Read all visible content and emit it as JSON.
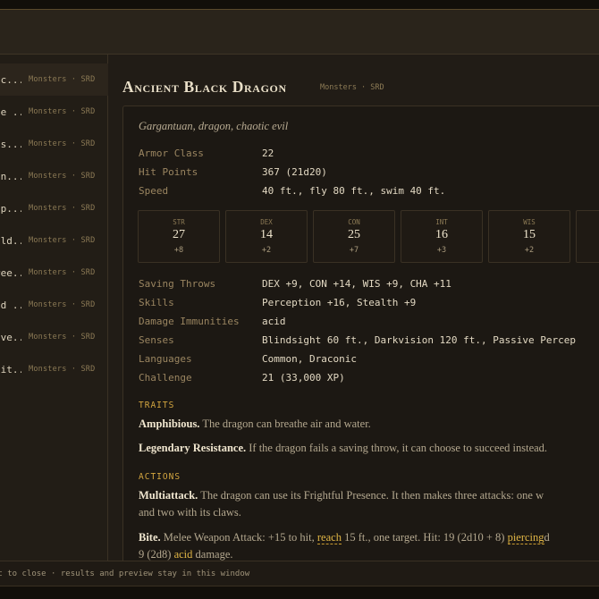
{
  "results": [
    {
      "name": "ac...",
      "meta": "Monsters · SRD"
    },
    {
      "name": "ue ...",
      "meta": "Monsters · SRD"
    },
    {
      "name": "as...",
      "meta": "Monsters · SRD"
    },
    {
      "name": "on...",
      "meta": "Monsters · SRD"
    },
    {
      "name": "op...",
      "meta": "Monsters · SRD"
    },
    {
      "name": "old...",
      "meta": "Monsters · SRD"
    },
    {
      "name": "ree...",
      "meta": "Monsters · SRD"
    },
    {
      "name": "ed ...",
      "meta": "Monsters · SRD"
    },
    {
      "name": "ive...",
      "meta": "Monsters · SRD"
    },
    {
      "name": "hit...",
      "meta": "Monsters · SRD"
    }
  ],
  "monster": {
    "name": "Ancient Black Dragon",
    "meta": "Monsters · SRD",
    "subtitle": "Gargantuan, dragon, chaotic evil",
    "props_top": [
      {
        "label": "Armor Class",
        "value": "22"
      },
      {
        "label": "Hit Points",
        "value": "367 (21d20)"
      },
      {
        "label": "Speed",
        "value": "40 ft., fly 80 ft., swim 40 ft."
      }
    ],
    "abilities": [
      {
        "name": "STR",
        "score": "27",
        "mod": "+8"
      },
      {
        "name": "DEX",
        "score": "14",
        "mod": "+2"
      },
      {
        "name": "CON",
        "score": "25",
        "mod": "+7"
      },
      {
        "name": "INT",
        "score": "16",
        "mod": "+3"
      },
      {
        "name": "WIS",
        "score": "15",
        "mod": "+2"
      },
      {
        "name": "",
        "score": "",
        "mod": ""
      }
    ],
    "props_bottom": [
      {
        "label": "Saving Throws",
        "value": "DEX +9, CON +14, WIS +9, CHA +11"
      },
      {
        "label": "Skills",
        "value": "Perception +16, Stealth +9"
      },
      {
        "label": "Damage Immunities",
        "value": "acid"
      },
      {
        "label": "Senses",
        "value": "Blindsight 60 ft., Darkvision 120 ft., Passive Percep"
      },
      {
        "label": "Languages",
        "value": "Common, Draconic"
      },
      {
        "label": "Challenge",
        "value": "21 (33,000 XP)"
      }
    ],
    "traits_heading": "TRAITS",
    "traits": [
      {
        "name": "Amphibious.",
        "text": "The dragon can breathe air and water."
      },
      {
        "name": "Legendary Resistance.",
        "text": "If the dragon fails a saving throw, it can choose to succeed instead."
      }
    ],
    "actions_heading": "ACTIONS",
    "multiattack": {
      "name": "Multiattack.",
      "text": "The dragon can use its Frightful Presence. It then makes three attacks: one w",
      "text2": "and two with its claws."
    },
    "bite": {
      "name": "Bite.",
      "part1": "Melee Weapon Attack: +15 to hit,",
      "term1": "reach",
      "part2": "15 ft., one target. Hit: 19 (2d10 + 8)",
      "term2": "piercing",
      "part3": "d",
      "part4": "9 (2d8)",
      "term3": "acid",
      "part5": "damage."
    }
  },
  "status": "sc to close · results and preview stay in this window"
}
